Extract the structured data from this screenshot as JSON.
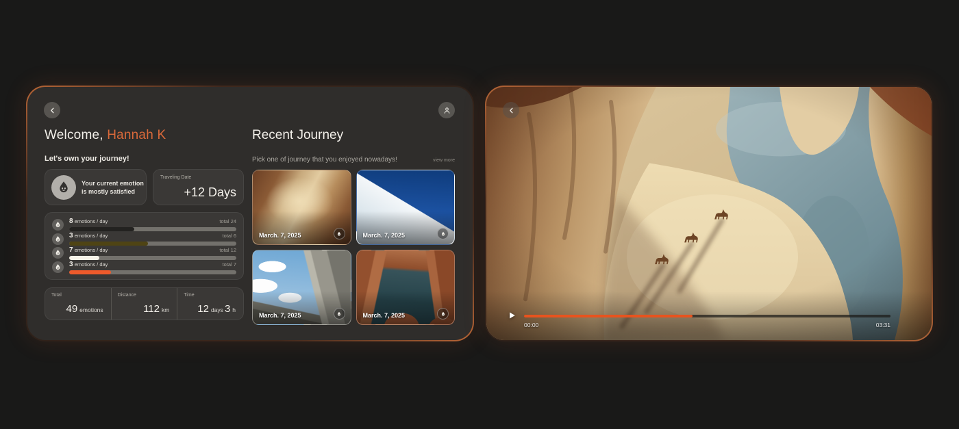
{
  "colors": {
    "accent_text": "#d9693a",
    "accent_bar": "#ee5a2b",
    "video_progress": "#e8531e",
    "panel_glow": "#b4562c",
    "panel_bg": "#2f2d2b"
  },
  "icons": {
    "back": "chevron-left-icon",
    "profile": "user-icon",
    "emotion": "emotion-drop-icon",
    "play": "play-icon",
    "journey_badge": "emotion-drop-icon"
  },
  "left": {
    "welcome_prefix": "Welcome, ",
    "user_name": "Hannah K",
    "tagline": "Let's own your journey!",
    "emotion_card": {
      "line1": "Your current emotion",
      "line2": "is mostly satisfied"
    },
    "travel_card": {
      "label": "Traveling Date",
      "value": "+12 Days"
    },
    "emotion_stats": [
      {
        "count": "8",
        "label": "emotions / day",
        "total": "total 24",
        "percent": 39,
        "color": "#232220"
      },
      {
        "count": "3",
        "label": "emotions / day",
        "total": "total 6",
        "percent": 47,
        "color": "#4f4414"
      },
      {
        "count": "7",
        "label": "emotions / day",
        "total": "total 12",
        "percent": 18,
        "color": "#f7f3e8"
      },
      {
        "count": "3",
        "label": "emotions / day",
        "total": "total 7",
        "percent": 25,
        "color": "#ee5a2b"
      }
    ],
    "summary": [
      {
        "label": "Total",
        "value": "49",
        "unit": "emotions",
        "value2": "",
        "unit2": ""
      },
      {
        "label": "Distance",
        "value": "112",
        "unit": "km",
        "value2": "",
        "unit2": ""
      },
      {
        "label": "Time",
        "value": "12",
        "unit": "days",
        "value2": "3",
        "unit2": "h"
      }
    ]
  },
  "journey": {
    "title": "Recent Journey",
    "subtitle": "Pick one of journey that you enjoyed nowadays!",
    "view_more": "view more",
    "cards": [
      {
        "date": "March. 7, 2025",
        "scene": "desert-canyon"
      },
      {
        "date": "March. 7, 2025",
        "scene": "snow-mountain"
      },
      {
        "date": "March. 7, 2025",
        "scene": "rocky-cliffs"
      },
      {
        "date": "March. 7, 2025",
        "scene": "canyon-lake"
      }
    ]
  },
  "video": {
    "scene": "desert-canyon-with-camels",
    "current_time": "00:00",
    "duration": "03:31",
    "progress_percent": 46
  }
}
